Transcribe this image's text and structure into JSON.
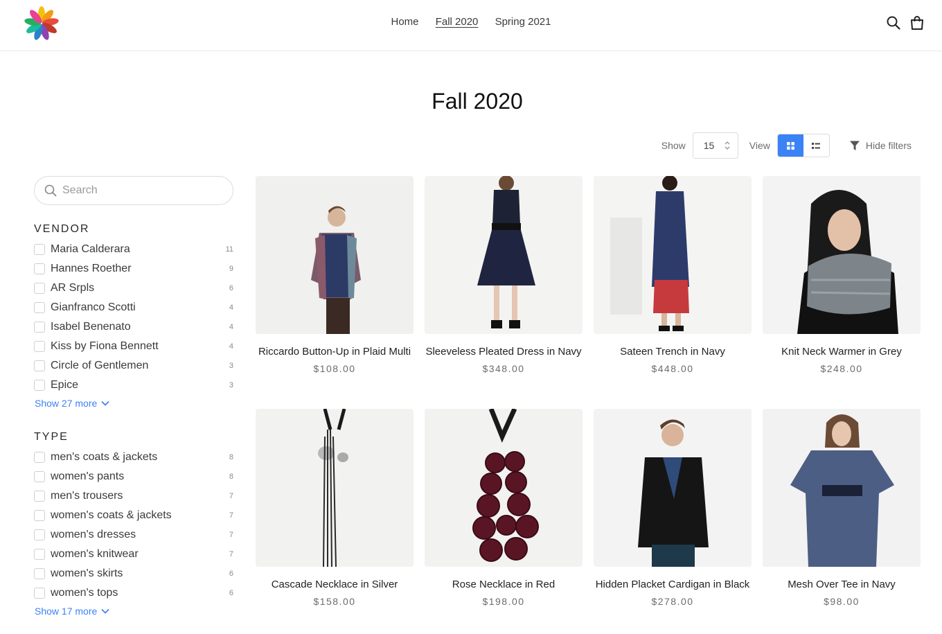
{
  "header": {
    "nav": [
      "Home",
      "Fall 2020",
      "Spring 2021"
    ],
    "active_nav": "Fall 2020"
  },
  "page": {
    "title": "Fall 2020"
  },
  "toolbar": {
    "show_label": "Show",
    "show_value": "15",
    "view_label": "View",
    "hide_filters": "Hide filters"
  },
  "sidebar": {
    "search_placeholder": "Search",
    "vendor": {
      "title": "VENDOR",
      "items": [
        {
          "label": "Maria Calderara",
          "count": "11"
        },
        {
          "label": "Hannes Roether",
          "count": "9"
        },
        {
          "label": "AR Srpls",
          "count": "6"
        },
        {
          "label": "Gianfranco Scotti",
          "count": "4"
        },
        {
          "label": "Isabel Benenato",
          "count": "4"
        },
        {
          "label": "Kiss by Fiona Bennett",
          "count": "4"
        },
        {
          "label": "Circle of Gentlemen",
          "count": "3"
        },
        {
          "label": "Epice",
          "count": "3"
        }
      ],
      "more": "Show 27 more"
    },
    "type": {
      "title": "TYPE",
      "items": [
        {
          "label": "men's coats & jackets",
          "count": "8"
        },
        {
          "label": "women's pants",
          "count": "8"
        },
        {
          "label": "men's trousers",
          "count": "7"
        },
        {
          "label": "women's coats & jackets",
          "count": "7"
        },
        {
          "label": "women's dresses",
          "count": "7"
        },
        {
          "label": "women's knitwear",
          "count": "7"
        },
        {
          "label": "women's skirts",
          "count": "6"
        },
        {
          "label": "women's tops",
          "count": "6"
        }
      ],
      "more": "Show 17 more"
    }
  },
  "products": [
    {
      "name": "Riccardo Button-Up in Plaid Multi",
      "price": "$108.00"
    },
    {
      "name": "Sleeveless Pleated Dress in Navy",
      "price": "$348.00"
    },
    {
      "name": "Sateen Trench in Navy",
      "price": "$448.00"
    },
    {
      "name": "Knit Neck Warmer in Grey",
      "price": "$248.00"
    },
    {
      "name": "Cascade Necklace in Silver",
      "price": "$158.00"
    },
    {
      "name": "Rose Necklace in Red",
      "price": "$198.00"
    },
    {
      "name": "Hidden Placket Cardigan in Black",
      "price": "$278.00"
    },
    {
      "name": "Mesh Over Tee in Navy",
      "price": "$98.00"
    }
  ],
  "colors": {
    "accent": "#3b82f6",
    "text": "#3a3a3a",
    "muted": "#6b6b6b"
  }
}
